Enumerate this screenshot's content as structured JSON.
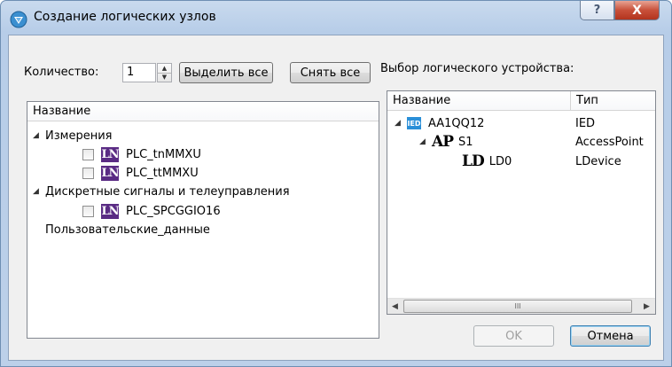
{
  "window": {
    "title": "Создание логических узлов",
    "help_label": "?",
    "close_label": "X"
  },
  "left": {
    "quantity_label": "Количество:",
    "quantity_value": "1",
    "select_all_label": "Выделить все",
    "deselect_all_label": "Снять все",
    "column_header": "Название",
    "tree": [
      {
        "type": "group",
        "label": "Измерения"
      },
      {
        "type": "item",
        "icon": "LN",
        "label": "PLC_tnMMXU",
        "checked": false
      },
      {
        "type": "item",
        "icon": "LN",
        "label": "PLC_ttMMXU",
        "checked": false
      },
      {
        "type": "group",
        "label": "Дискретные сигналы и телеуправления"
      },
      {
        "type": "item",
        "icon": "LN",
        "label": "PLC_SPCGGIO16",
        "checked": false
      },
      {
        "type": "leaf",
        "label": "Пользовательские_данные"
      }
    ]
  },
  "right": {
    "title": "Выбор логического устройства:",
    "col_name": "Название",
    "col_type": "Тип",
    "rows": [
      {
        "icon": "IED",
        "name": "AA1QQ12",
        "type": "IED"
      },
      {
        "icon": "AP",
        "name": "S1",
        "type": "AccessPoint"
      },
      {
        "icon": "LD",
        "name": "LD0",
        "type": "LDevice"
      }
    ],
    "scroll_left": "◀",
    "scroll_right": "▶",
    "scroll_grip": "III"
  },
  "footer": {
    "ok_label": "OK",
    "cancel_label": "Отмена"
  },
  "icons": {
    "expand": "◢",
    "ln": "LN",
    "ied": "IED",
    "ap": "AP",
    "ld": "LD"
  },
  "colors": {
    "ln_icon": "#5a2b84",
    "ied_icon": "#2a8fd8",
    "close_button": "#c8503a"
  }
}
